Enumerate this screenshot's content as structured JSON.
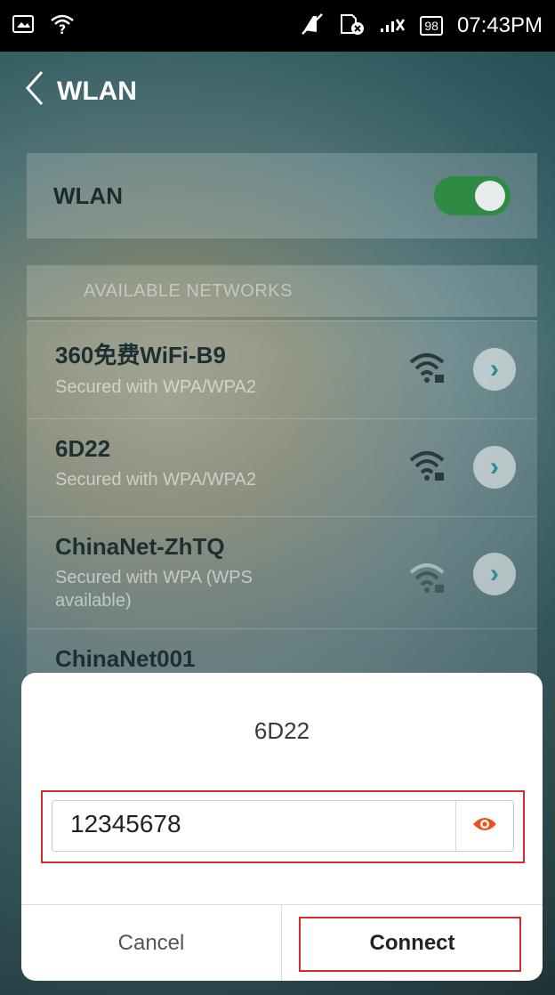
{
  "status_bar": {
    "time": "07:43PM",
    "battery": "98",
    "icons": [
      "screenshot-icon",
      "wifi-question-icon",
      "mute-icon",
      "sim-error-icon",
      "signal-icon"
    ]
  },
  "header": {
    "title": "WLAN",
    "back_icon": "chevron-left-icon"
  },
  "wlan_toggle": {
    "label": "WLAN",
    "state": "on"
  },
  "section": {
    "title": "AVAILABLE NETWORKS"
  },
  "networks": [
    {
      "name": "360免费WiFi-B9",
      "security": "Secured with WPA/WPA2"
    },
    {
      "name": "6D22",
      "security": "Secured with WPA/WPA2"
    },
    {
      "name": "ChinaNet-ZhTQ",
      "security": "Secured with WPA (WPS available)"
    },
    {
      "name": "ChinaNet001",
      "security": ""
    }
  ],
  "dialog": {
    "title": "6D22",
    "password_value": "12345678",
    "cancel_label": "Cancel",
    "connect_label": "Connect"
  },
  "colors": {
    "toggle_on": "#2f8a43",
    "eye_icon": "#e8531c",
    "highlight": "#d32a2a"
  }
}
